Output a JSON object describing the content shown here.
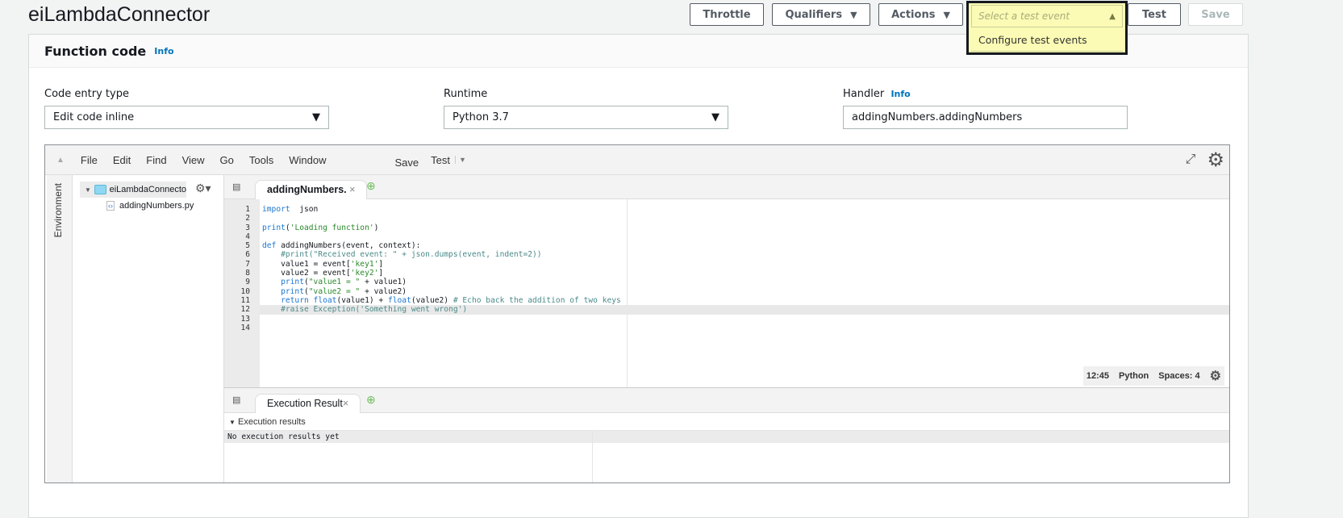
{
  "header": {
    "title": "eiLambdaConnector",
    "buttons": {
      "throttle": "Throttle",
      "qualifiers": "Qualifiers",
      "actions": "Actions",
      "test": "Test",
      "save": "Save"
    },
    "test_event": {
      "placeholder": "Select a test event",
      "options": [
        "Configure test events"
      ]
    }
  },
  "panel": {
    "title": "Function code",
    "info": "Info",
    "code_entry_type": {
      "label": "Code entry type",
      "value": "Edit code inline"
    },
    "runtime": {
      "label": "Runtime",
      "value": "Python 3.7"
    },
    "handler": {
      "label": "Handler",
      "info": "Info",
      "value": "addingNumbers.addingNumbers"
    }
  },
  "ide": {
    "menu": [
      "File",
      "Edit",
      "Find",
      "View",
      "Go",
      "Tools",
      "Window"
    ],
    "save": "Save",
    "test": "Test",
    "env_tab": "Environment",
    "tree": {
      "folder": "eiLambdaConnecto",
      "file": "addingNumbers.py"
    },
    "tab": "addingNumbers.",
    "lines": [
      [
        [
          "kw",
          "import"
        ],
        [
          "",
          "  json"
        ]
      ],
      [],
      [
        [
          "kw",
          "print"
        ],
        [
          "",
          "("
        ],
        [
          "st",
          "'Loading function'"
        ],
        [
          "",
          ")"
        ]
      ],
      [],
      [
        [
          "kw",
          "def"
        ],
        [
          "",
          " addingNumbers(event, context):"
        ]
      ],
      [
        [
          "cm",
          "    #print(\"Received event: \" + json.dumps(event, indent=2))"
        ]
      ],
      [
        [
          "",
          "    value1 = event["
        ],
        [
          "st",
          "'key1'"
        ],
        [
          "",
          "]"
        ]
      ],
      [
        [
          "",
          "    value2 = event["
        ],
        [
          "st",
          "'key2'"
        ],
        [
          "",
          "]"
        ]
      ],
      [
        [
          "",
          "    "
        ],
        [
          "kw",
          "print"
        ],
        [
          "",
          "("
        ],
        [
          "st",
          "\"value1 = \""
        ],
        [
          "",
          " + value1)"
        ]
      ],
      [
        [
          "",
          "    "
        ],
        [
          "kw",
          "print"
        ],
        [
          "",
          "("
        ],
        [
          "st",
          "\"value2 = \""
        ],
        [
          "",
          " + value2)"
        ]
      ],
      [
        [
          "",
          "    "
        ],
        [
          "kw",
          "return"
        ],
        [
          "",
          " "
        ],
        [
          "kw",
          "float"
        ],
        [
          "",
          "(value1) + "
        ],
        [
          "kw",
          "float"
        ],
        [
          "",
          "(value2) "
        ],
        [
          "cm",
          "# Echo back the addition of two keys"
        ]
      ],
      [
        [
          "cm",
          "    #raise Exception('Something went wrong')"
        ]
      ],
      [],
      []
    ],
    "highlight_line": 12,
    "status": {
      "position": "12:45",
      "language": "Python",
      "spaces": "Spaces: 4"
    },
    "bottom_tab": "Execution Result",
    "results_header": "Execution results",
    "results_text": "No execution results yet"
  }
}
